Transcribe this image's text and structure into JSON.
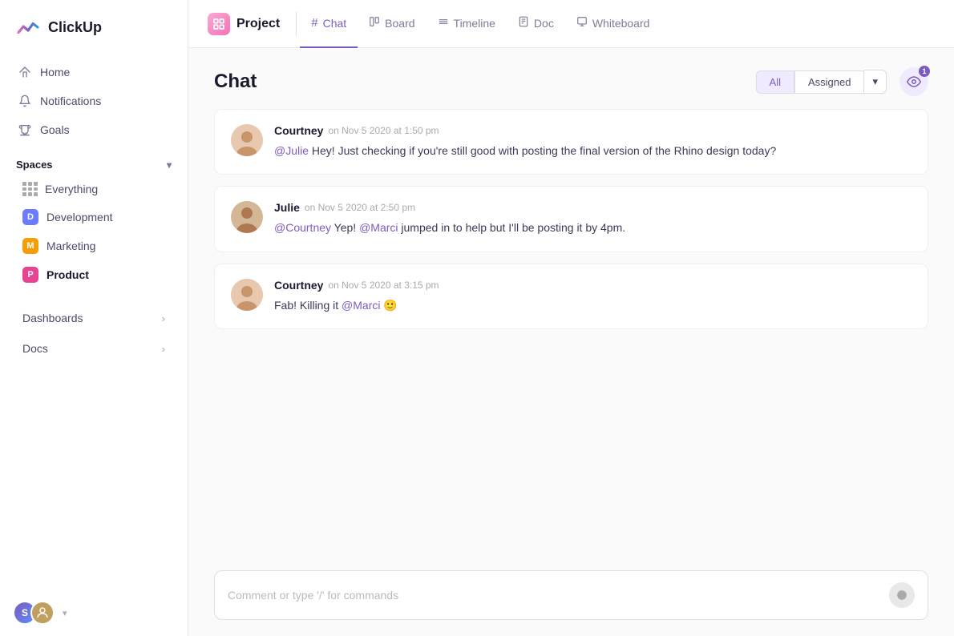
{
  "app": {
    "logo_text": "ClickUp"
  },
  "sidebar": {
    "nav_items": [
      {
        "id": "home",
        "label": "Home",
        "icon": "🏠"
      },
      {
        "id": "notifications",
        "label": "Notifications",
        "icon": "🔔"
      },
      {
        "id": "goals",
        "label": "Goals",
        "icon": "🏆"
      }
    ],
    "spaces_label": "Spaces",
    "spaces": [
      {
        "id": "everything",
        "label": "Everything",
        "type": "grid",
        "color": null
      },
      {
        "id": "development",
        "label": "Development",
        "type": "dot",
        "color": "#6c7bff",
        "letter": "D"
      },
      {
        "id": "marketing",
        "label": "Marketing",
        "type": "dot",
        "color": "#f59e0b",
        "letter": "M"
      },
      {
        "id": "product",
        "label": "Product",
        "type": "dot",
        "color": "#e84393",
        "letter": "P",
        "active": true
      }
    ],
    "sections": [
      {
        "id": "dashboards",
        "label": "Dashboards"
      },
      {
        "id": "docs",
        "label": "Docs"
      }
    ],
    "footer_initials": "S"
  },
  "topbar": {
    "project_name": "Project",
    "tabs": [
      {
        "id": "chat",
        "label": "Chat",
        "icon": "#",
        "active": true
      },
      {
        "id": "board",
        "label": "Board",
        "icon": "⬜"
      },
      {
        "id": "timeline",
        "label": "Timeline",
        "icon": "≡"
      },
      {
        "id": "doc",
        "label": "Doc",
        "icon": "📄"
      },
      {
        "id": "whiteboard",
        "label": "Whiteboard",
        "icon": "✏️"
      }
    ]
  },
  "chat": {
    "title": "Chat",
    "filter_all": "All",
    "filter_assigned": "Assigned",
    "eye_badge": "1",
    "messages": [
      {
        "id": "msg1",
        "author": "Courtney",
        "time": "on Nov 5 2020 at 1:50 pm",
        "mention": "@Julie",
        "text_pre": "",
        "text_main": " Hey! Just checking if you're still good with posting the final version of the Rhino design today?",
        "avatar_emoji": "👩"
      },
      {
        "id": "msg2",
        "author": "Julie",
        "time": "on Nov 5 2020 at 2:50 pm",
        "mention": "@Courtney",
        "text_pre": " Yep! ",
        "mention2": "@Marci",
        "text_after": " jumped in to help but I'll be posting it by 4pm.",
        "avatar_emoji": "👩"
      },
      {
        "id": "msg3",
        "author": "Courtney",
        "time": "on Nov 5 2020 at 3:15 pm",
        "mention": "",
        "text_pre": "Fab! Killing it ",
        "mention2": "@Marci",
        "text_after": " 🙂",
        "avatar_emoji": "👩"
      }
    ],
    "comment_placeholder": "Comment or type '/' for commands"
  }
}
